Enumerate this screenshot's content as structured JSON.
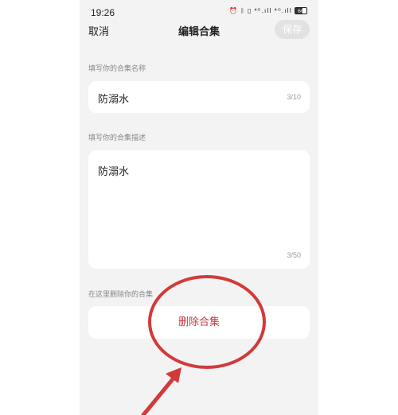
{
  "status_bar": {
    "time": "19:26",
    "icons": [
      "alarm-icon",
      "bluetooth-icon",
      "vibrate-icon",
      "signal-4g-icon",
      "signal-hd-icon",
      "battery-icon"
    ],
    "signal_text_1": "⁴ᴳ.ıll",
    "signal_text_2": "⁴ᴳ.ıll",
    "battery_level": "66"
  },
  "nav": {
    "cancel_label": "取消",
    "title": "编辑合集",
    "save_label": "保存"
  },
  "name_section": {
    "label": "填写你的合集名称",
    "value": "防溺水",
    "count": "3/10"
  },
  "desc_section": {
    "label": "填写你的合集描述",
    "value": "防溺水",
    "count": "3/50"
  },
  "delete_section": {
    "label": "在这里删除你的合集",
    "button_label": "删除合集"
  },
  "annotation": {
    "color": "#d23a3a",
    "circle-icon": "highlight-circle",
    "arrow-icon": "pointer-arrow"
  }
}
